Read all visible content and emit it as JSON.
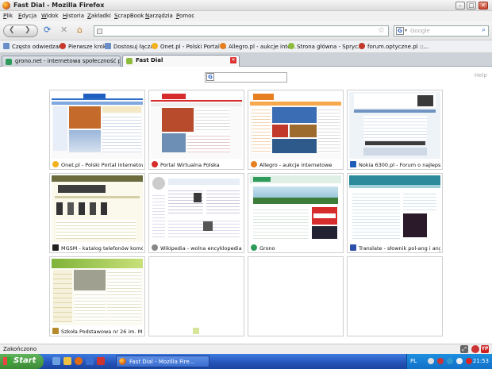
{
  "window": {
    "title": "Fast Dial - Mozilla Firefox"
  },
  "menu": [
    "Plik",
    "Edycja",
    "Widok",
    "Historia",
    "Zakładki",
    "ScrapBook",
    "Narzędzia",
    "Pomoc"
  ],
  "search": {
    "placeholder": "Google",
    "engine_icon": "google-icon"
  },
  "bookmarks": [
    {
      "label": "Często odwiedzane",
      "icon": "page-icon",
      "color": "#6a8fc8"
    },
    {
      "label": "Pierwsze kroki",
      "icon": "firefox-icon",
      "color": "#c8392b"
    },
    {
      "label": "Dostosuj łącza",
      "icon": "page-icon",
      "color": "#6a8fc8"
    },
    {
      "label": "Onet.pl - Polski Portal ...",
      "icon": "onet-icon",
      "color": "#f2b21b"
    },
    {
      "label": "Allegro.pl - aukcje inte...",
      "icon": "allegro-icon",
      "color": "#e67e22"
    },
    {
      "label": "Strona główna - Spryc...",
      "icon": "leaf-icon",
      "color": "#8dbb3c"
    },
    {
      "label": "forum.optyczne.pl ::...",
      "icon": "optyczne-icon",
      "color": "#c0392b"
    }
  ],
  "tabs": [
    {
      "label": "grono.net - internetowa społeczność p...",
      "icon_color": "#2e9b5a"
    },
    {
      "label": "Fast Dial",
      "icon_color": "#8dbb3c"
    }
  ],
  "help_label": "Help",
  "dials": [
    {
      "label": "Onet.pl - Polski Portal Internetow",
      "icon": "onet-icon",
      "icon_color": "#f2b21b"
    },
    {
      "label": "Portal Wirtualna Polska",
      "icon": "wp-icon",
      "icon_color": "#d62c2c"
    },
    {
      "label": "Allegro - aukcje internetowe",
      "icon": "allegro-icon",
      "icon_color": "#e67e22"
    },
    {
      "label": "Nokia 6300.pl - Forum o najlepsz",
      "icon": "nokia-icon",
      "icon_color": "#1f5db8"
    },
    {
      "label": "MGSM - katalog telefonów komórl",
      "icon": "mgsm-icon",
      "icon_color": "#222222"
    },
    {
      "label": "Wikipedia - wolna encyklopedia",
      "icon": "wikipedia-icon",
      "icon_color": "#888888"
    },
    {
      "label": "Grono",
      "icon": "grono-icon",
      "icon_color": "#2e9b5a"
    },
    {
      "label": "Translate - słownik pol-ang i ang-",
      "icon": "translate-icon",
      "icon_color": "#2c4fa8"
    },
    {
      "label": "Szkoła Podstawowa nr 26 im. Min",
      "icon": "school-icon",
      "icon_color": "#b58b2a"
    },
    {
      "label": "",
      "icon": "",
      "icon_color": ""
    },
    {
      "label": "",
      "icon": "",
      "icon_color": ""
    },
    {
      "label": "",
      "icon": "",
      "icon_color": ""
    }
  ],
  "status": {
    "text": "Zakończono"
  },
  "taskbar": {
    "start_label": "Start",
    "task_label": "Fast Dial - Mozilla Fire...",
    "lang": "PL",
    "clock": "21:53"
  }
}
